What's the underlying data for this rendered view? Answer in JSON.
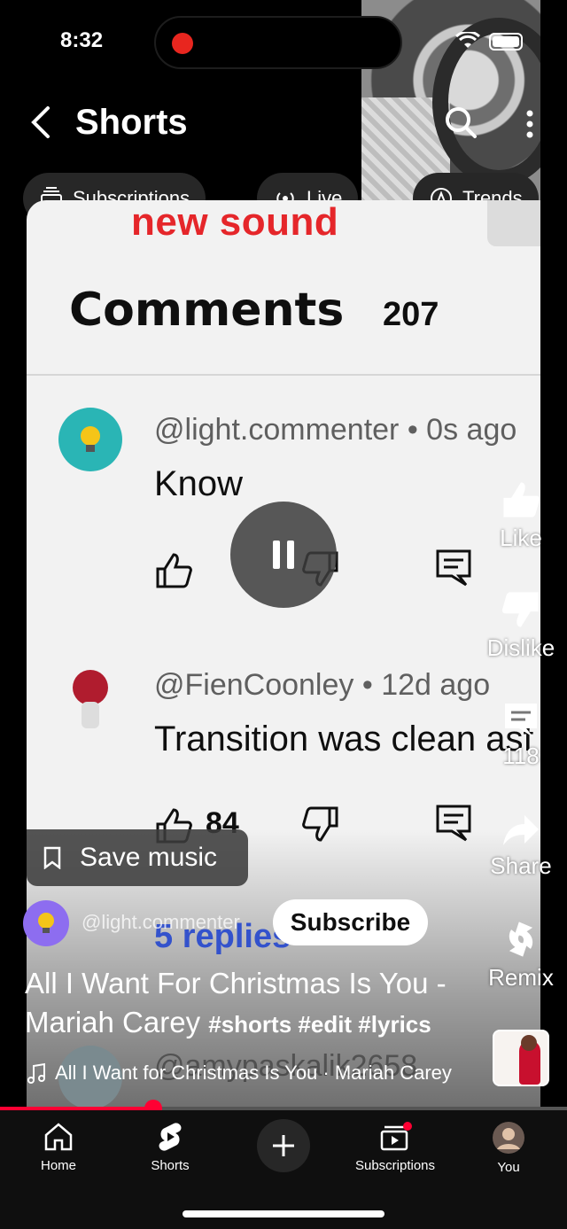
{
  "status_bar": {
    "time": "8:32"
  },
  "header": {
    "title": "Shorts"
  },
  "chips": [
    {
      "label": "Subscriptions"
    },
    {
      "label": "Live"
    },
    {
      "label": "Trends"
    }
  ],
  "video": {
    "overlay_caption": "new sound",
    "comments_title": "Comments",
    "comments_count": "207",
    "comments": [
      {
        "user": "@light.commenter • 0s ago",
        "text": "Know",
        "likes": ""
      },
      {
        "user": "@FienCoonley • 12d ago",
        "text": "Transition was clean asf",
        "likes": "84"
      }
    ],
    "replies_text": "5 replies",
    "ghost_user": "@amypaskalik2658",
    "progress_fraction": 0.27
  },
  "rail": {
    "like_label": "Like",
    "dislike_label": "Dislike",
    "comments_count": "118",
    "share_label": "Share",
    "remix_label": "Remix"
  },
  "overlay": {
    "save_music_label": "Save music",
    "channel_name": "@light.commenter",
    "subscribe_label": "Subscribe",
    "title": "All I Want For Christmas Is You - Mariah Carey",
    "hashtags": "#shorts #edit #lyrics",
    "music_track": "All I Want for Christmas Is You · Mariah Carey"
  },
  "bottom_nav": {
    "home": "Home",
    "shorts": "Shorts",
    "subscriptions": "Subscriptions",
    "you": "You"
  },
  "colors": {
    "accent": "#ff0033",
    "caption_red": "#e5262a",
    "nav_bg": "#0f0f0f"
  }
}
